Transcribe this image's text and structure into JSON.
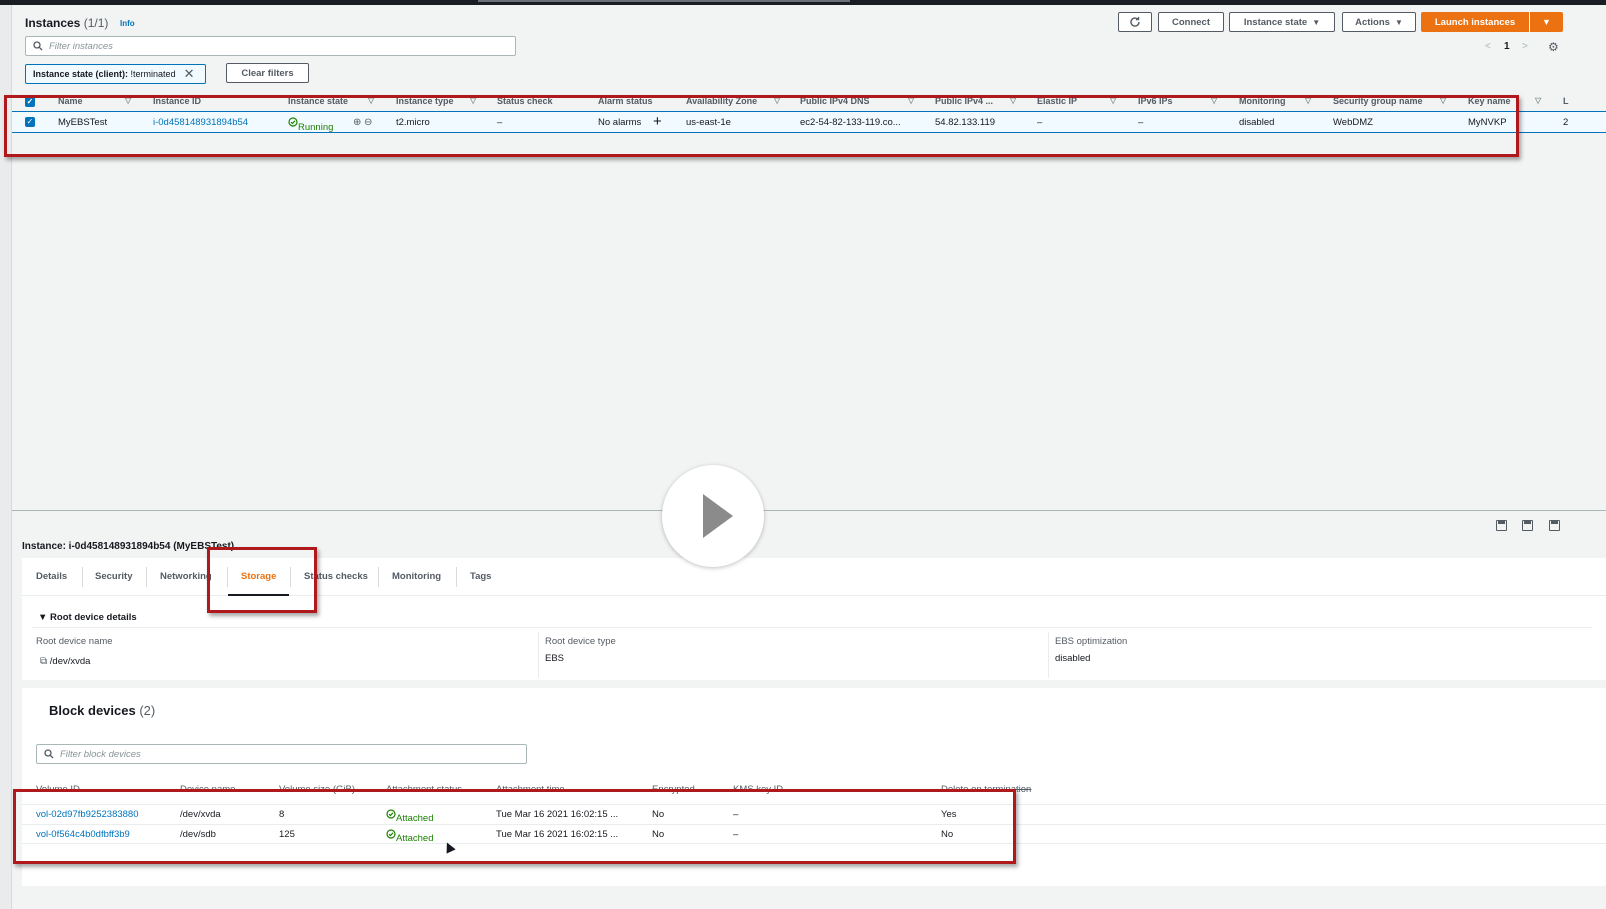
{
  "instances": {
    "title": "Instances",
    "count": "(1/1)",
    "info_label": "Info",
    "buttons": {
      "connect": "Connect",
      "instance_state": "Instance state",
      "actions": "Actions",
      "launch": "Launch instances"
    },
    "search_placeholder": "Filter instances",
    "filter_token": {
      "key": "Instance state (client):",
      "value": "!terminated"
    },
    "clear_filters": "Clear filters",
    "page_number": "1",
    "columns": [
      "Name",
      "Instance ID",
      "Instance state",
      "Instance type",
      "Status check",
      "Alarm status",
      "Availability Zone",
      "Public IPv4 DNS",
      "Public IPv4 ...",
      "Elastic IP",
      "IPv6 IPs",
      "Monitoring",
      "Security group name",
      "Key name",
      "L"
    ],
    "row": {
      "name": "MyEBSTest",
      "instance_id": "i-0d458148931894b54",
      "state": "Running",
      "type": "t2.micro",
      "status_check": "–",
      "alarm_status": "No alarms",
      "az": "us-east-1e",
      "dns": "ec2-54-82-133-119.co...",
      "ipv4": "54.82.133.119",
      "elastic_ip": "–",
      "ipv6": "–",
      "monitoring": "disabled",
      "security_group": "WebDMZ",
      "key_name": "MyNVKP",
      "extra": "2"
    }
  },
  "detail": {
    "title": "Instance: i-0d458148931894b54 (MyEBSTest)",
    "tabs": [
      "Details",
      "Security",
      "Networking",
      "Storage",
      "Status checks",
      "Monitoring",
      "Tags"
    ],
    "active_tab": "Storage",
    "root_section": "Root device details",
    "root_device_name_label": "Root device name",
    "root_device_name": "/dev/xvda",
    "root_device_type_label": "Root device type",
    "root_device_type": "EBS",
    "ebs_optimization_label": "EBS optimization",
    "ebs_optimization": "disabled",
    "block_devices_title": "Block devices",
    "block_devices_count": "(2)",
    "block_search_placeholder": "Filter block devices",
    "block_columns": [
      "Volume ID",
      "Device name",
      "Volume size (GiB)",
      "Attachment status",
      "Attachment time",
      "Encrypted",
      "KMS key ID",
      "Delete on termination"
    ],
    "block_rows": [
      {
        "volume_id": "vol-02d97fb9252383880",
        "device": "/dev/xvda",
        "size": "8",
        "status": "Attached",
        "time": "Tue Mar 16 2021 16:02:15 ...",
        "encrypted": "No",
        "kms": "–",
        "delete": "Yes"
      },
      {
        "volume_id": "vol-0f564c4b0dfbff3b9",
        "device": "/dev/sdb",
        "size": "125",
        "status": "Attached",
        "time": "Tue Mar 16 2021 16:02:15 ...",
        "encrypted": "No",
        "kms": "–",
        "delete": "No"
      }
    ]
  },
  "colors": {
    "accent": "#ec7211",
    "link": "#0073bb",
    "success": "#1d8102",
    "highlight": "#b0191c"
  },
  "icons": [
    "refresh-icon",
    "search-icon",
    "close-icon",
    "settings-icon",
    "check-circle-icon",
    "zoom-in-icon",
    "zoom-out-icon",
    "plus-icon",
    "copy-icon",
    "play-icon"
  ]
}
